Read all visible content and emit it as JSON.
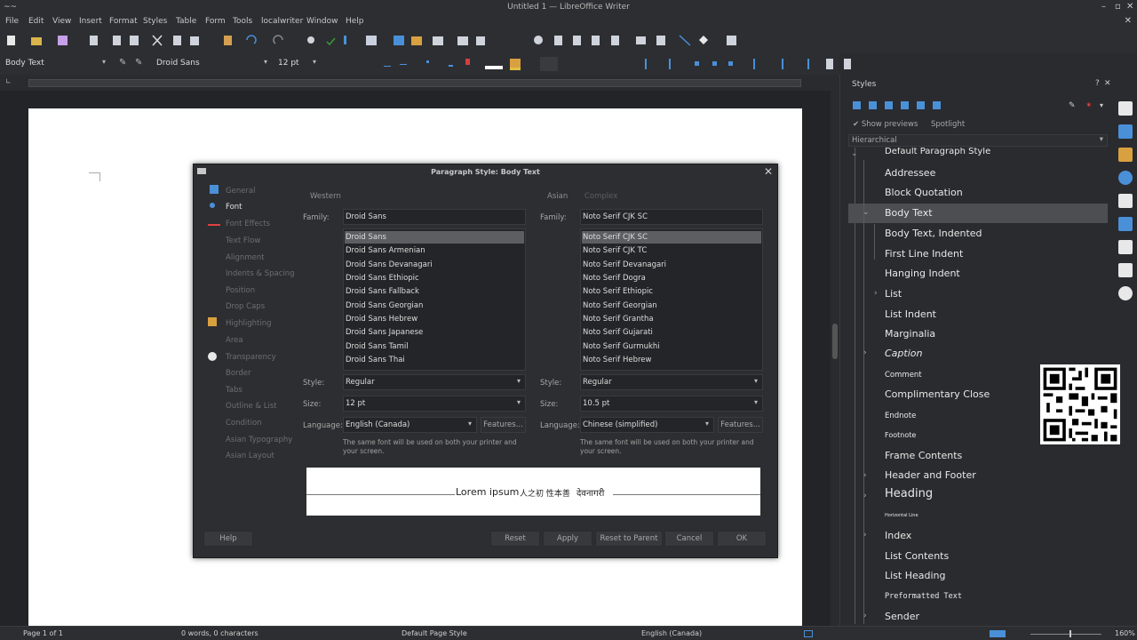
{
  "window": {
    "title": "Untitled 1 — LibreOffice Writer",
    "app_icon": "~~"
  },
  "menu": [
    "File",
    "Edit",
    "View",
    "Insert",
    "Format",
    "Styles",
    "Table",
    "Form",
    "Tools",
    "localwriter",
    "Window",
    "Help"
  ],
  "toolbar": {
    "paragraph_style": "Body Text",
    "font_name": "Droid Sans",
    "font_size": "12 pt"
  },
  "statusbar": {
    "page": "Page 1 of 1",
    "words": "0 words, 0 characters",
    "page_style": "Default Page Style",
    "language": "English (Canada)",
    "zoom": "160%"
  },
  "sidebar": {
    "title": "Styles",
    "show_previews": "Show previews",
    "spotlight": "Spotlight",
    "filter": "Hierarchical",
    "items": [
      {
        "label": "Default Paragraph Style"
      },
      {
        "label": "Addressee"
      },
      {
        "label": "Block Quotation"
      },
      {
        "label": "Body Text"
      },
      {
        "label": "Body Text, Indented"
      },
      {
        "label": "First Line Indent"
      },
      {
        "label": "Hanging Indent"
      },
      {
        "label": "List"
      },
      {
        "label": "List Indent"
      },
      {
        "label": "Marginalia"
      },
      {
        "label": "Caption"
      },
      {
        "label": "Comment"
      },
      {
        "label": "Complimentary Close"
      },
      {
        "label": "Endnote"
      },
      {
        "label": "Footnote"
      },
      {
        "label": "Frame Contents"
      },
      {
        "label": "Header and Footer"
      },
      {
        "label": "Heading"
      },
      {
        "label": "Horizontal Line"
      },
      {
        "label": "Index"
      },
      {
        "label": "List Contents"
      },
      {
        "label": "List Heading"
      },
      {
        "label": "Preformatted Text"
      },
      {
        "label": "Sender"
      }
    ]
  },
  "dialog": {
    "title": "Paragraph Style: Body Text",
    "nav": [
      "General",
      "Font",
      "Font Effects",
      "Text Flow",
      "Alignment",
      "Indents & Spacing",
      "Position",
      "Drop Caps",
      "Highlighting",
      "Area",
      "Transparency",
      "Border",
      "Tabs",
      "Outline & List",
      "Condition",
      "Asian Typography",
      "Asian Layout"
    ],
    "western": {
      "heading": "Western",
      "family_label": "Family:",
      "family": "Droid Sans",
      "fonts": [
        "Droid Sans",
        "Droid Sans Armenian",
        "Droid Sans Devanagari",
        "Droid Sans Ethiopic",
        "Droid Sans Fallback",
        "Droid Sans Georgian",
        "Droid Sans Hebrew",
        "Droid Sans Japanese",
        "Droid Sans Tamil",
        "Droid Sans Thai"
      ],
      "style_label": "Style:",
      "style": "Regular",
      "size_label": "Size:",
      "size": "12 pt",
      "language_label": "Language:",
      "language": "English (Canada)",
      "features": "Features...",
      "note": "The same font will be used on both your printer and your screen."
    },
    "asian": {
      "heading": "Asian",
      "complex": "Complex",
      "family_label": "Family:",
      "family": "Noto Serif CJK SC",
      "fonts": [
        "Noto Serif CJK SC",
        "Noto Serif CJK TC",
        "Noto Serif Devanagari",
        "Noto Serif Dogra",
        "Noto Serif Ethiopic",
        "Noto Serif Georgian",
        "Noto Serif Grantha",
        "Noto Serif Gujarati",
        "Noto Serif Gurmukhi",
        "Noto Serif Hebrew"
      ],
      "style_label": "Style:",
      "style": "Regular",
      "size_label": "Size:",
      "size": "10.5 pt",
      "language_label": "Language:",
      "language": "Chinese (simplified)",
      "features": "Features...",
      "note": "The same font will be used on both your printer and your screen."
    },
    "preview": {
      "latin": "Lorem ipsum",
      "cjk": "人之初 性本善",
      "ctl": "देवनागरी"
    },
    "buttons": {
      "help": "Help",
      "reset": "Reset",
      "apply": "Apply",
      "reset_parent": "Reset to Parent",
      "cancel": "Cancel",
      "ok": "OK"
    }
  }
}
